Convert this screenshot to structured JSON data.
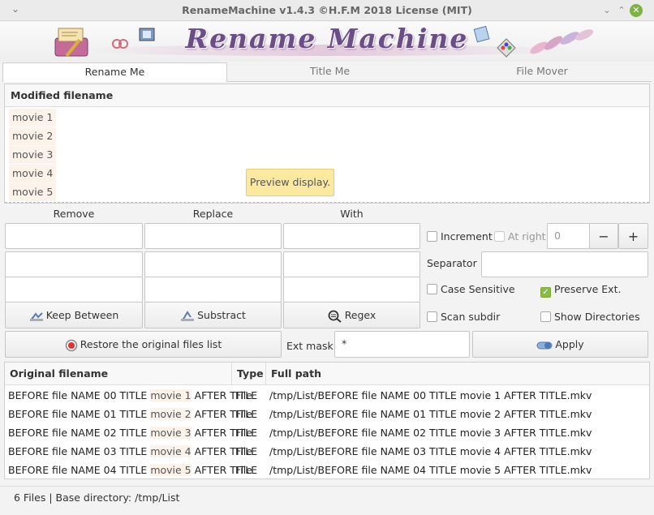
{
  "window": {
    "title": "RenameMachine v1.4.3  ©H.F.M 2018 License (MIT)"
  },
  "banner": {
    "logo_text": "Rename Machine"
  },
  "tabs": [
    {
      "label": "Rename Me",
      "active": true
    },
    {
      "label": "Title Me",
      "active": false
    },
    {
      "label": "File Mover",
      "active": false
    }
  ],
  "preview": {
    "header": "Modified filename",
    "rows": [
      "movie 1",
      "movie 2",
      "movie 3",
      "movie 4",
      "movie 5"
    ],
    "tooltip": "Preview display."
  },
  "columns": {
    "remove": "Remove",
    "replace": "Replace",
    "with": "With"
  },
  "buttons": {
    "keep_between": "Keep Between",
    "substract": "Substract",
    "regex": "Regex",
    "restore": "Restore the original files list",
    "apply": "Apply"
  },
  "options": {
    "increment": "Increment",
    "at_right": "At right",
    "counter_value": "0",
    "minus": "−",
    "plus": "+",
    "separator_label": "Separator :",
    "separator_value": "",
    "case_sensitive": "Case Sensitive",
    "preserve_ext": "Preserve  Ext.",
    "scan_subdir": "Scan subdir",
    "show_directories": "Show Directories",
    "ext_mask_label": "Ext mask :",
    "ext_mask_value": "*"
  },
  "table": {
    "headers": [
      "Original filename",
      "Type",
      "Full path"
    ],
    "rows": [
      {
        "pre": "BEFORE file NAME 00 TITLE ",
        "hl": "movie 1",
        "post": " AFTER TITLE",
        "type": "File",
        "path": "/tmp/List/BEFORE file NAME 00 TITLE movie 1 AFTER TITLE.mkv"
      },
      {
        "pre": "BEFORE file NAME 01 TITLE ",
        "hl": "movie 2",
        "post": " AFTER TITLE",
        "type": "File",
        "path": "/tmp/List/BEFORE file NAME 01 TITLE movie 2 AFTER TITLE.mkv"
      },
      {
        "pre": "BEFORE file NAME 02 TITLE ",
        "hl": "movie 3",
        "post": " AFTER TITLE",
        "type": "File",
        "path": "/tmp/List/BEFORE file NAME 02 TITLE movie 3 AFTER TITLE.mkv"
      },
      {
        "pre": "BEFORE file NAME 03 TITLE ",
        "hl": "movie 4",
        "post": " AFTER TITLE",
        "type": "File",
        "path": "/tmp/List/BEFORE file NAME 03 TITLE movie 4 AFTER TITLE.mkv"
      },
      {
        "pre": "BEFORE file NAME 04 TITLE ",
        "hl": "movie 5",
        "post": " AFTER TITLE",
        "type": "File",
        "path": "/tmp/List/BEFORE file NAME 04 TITLE movie 5 AFTER TITLE.mkv"
      }
    ]
  },
  "status": {
    "text": "6 Files | Base directory: /tmp/List"
  },
  "colors": {
    "accent_green": "#8bb94a",
    "highlight": "#fbf2ea",
    "tooltip": "#fbe9a0",
    "logo": "#6b4d8a"
  }
}
